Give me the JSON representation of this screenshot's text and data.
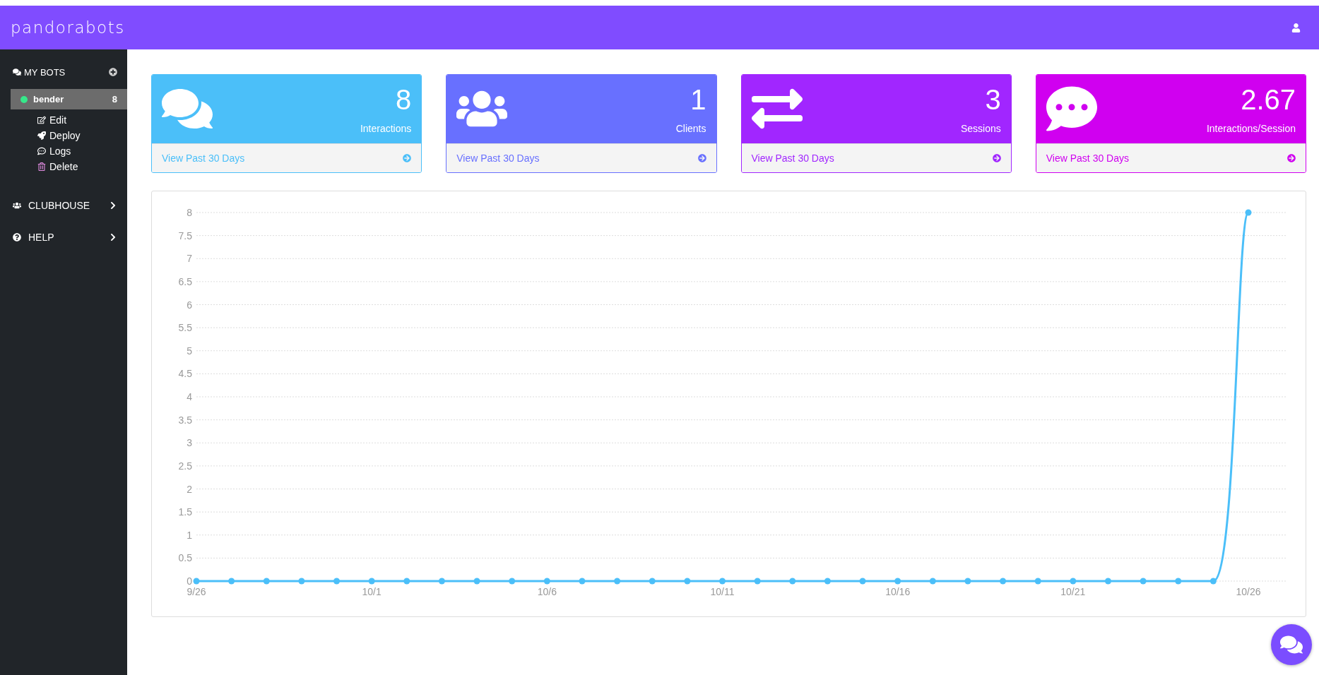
{
  "header": {
    "logo": "pandorabots"
  },
  "sidebar": {
    "section": {
      "label": "MY BOTS"
    },
    "bots": [
      {
        "name": "bender",
        "count": "8",
        "selected": true,
        "color": "#36e88a",
        "actions": [
          "Edit",
          "Deploy",
          "Logs",
          "Delete"
        ]
      }
    ],
    "nav": [
      {
        "label": "CLUBHOUSE",
        "expanded": false
      },
      {
        "label": "HELP",
        "expanded": false
      }
    ]
  },
  "cards": [
    {
      "value": "8",
      "label": "Interactions",
      "link": "View Past 30 Days",
      "color": "#4bbff9"
    },
    {
      "value": "1",
      "label": "Clients",
      "link": "View Past 30 Days",
      "color": "#6870ff"
    },
    {
      "value": "3",
      "label": "Sessions",
      "link": "View Past 30 Days",
      "color": "#a126ff"
    },
    {
      "value": "2.67",
      "label": "Interactions/Session",
      "link": "View Past 30 Days",
      "color": "#d000f0"
    }
  ],
  "chart": {
    "chart_data": {
      "type": "line",
      "categories": [
        "9/26",
        null,
        null,
        null,
        null,
        "10/1",
        null,
        null,
        null,
        null,
        "10/6",
        null,
        null,
        null,
        null,
        "10/11",
        null,
        null,
        null,
        null,
        "10/16",
        null,
        null,
        null,
        null,
        "10/21",
        null,
        null,
        null,
        null,
        "10/26"
      ],
      "grid": true,
      "series": [
        {
          "color": "#4bbff9",
          "marker": true,
          "values": [
            0,
            0,
            0,
            0,
            0,
            0,
            0,
            0,
            0,
            0,
            0,
            0,
            0,
            0,
            0,
            0,
            0,
            0,
            0,
            0,
            0,
            0,
            0,
            0,
            0,
            0,
            0,
            0,
            0,
            0,
            8
          ]
        }
      ],
      "ylim": [
        0,
        8
      ],
      "yticks": [
        0,
        0.5,
        1,
        1.5,
        2,
        2.5,
        3,
        3.5,
        4,
        4.5,
        5,
        5.5,
        6,
        6.5,
        7,
        7.5,
        8
      ]
    }
  }
}
